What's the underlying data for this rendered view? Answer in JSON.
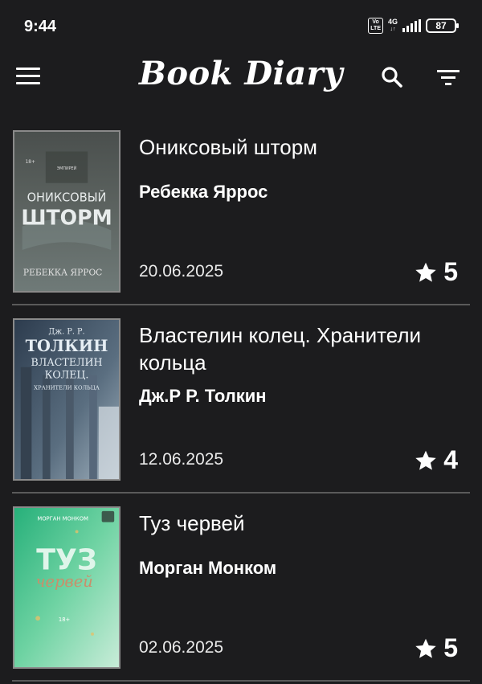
{
  "status_bar": {
    "time": "9:44",
    "volte": "Vo LTE",
    "network": "4G",
    "battery": "87"
  },
  "app_bar": {
    "title": "Book Diary",
    "menu_icon": "hamburger-menu-icon",
    "search_icon": "search-icon",
    "filter_icon": "filter-sort-icon"
  },
  "books": [
    {
      "title": "Ониксовый шторм",
      "author": "Ребекка Яррос",
      "date": "20.06.2025",
      "rating": "5",
      "cover": {
        "top_text": "ЭМПИРЕЙ",
        "badge": "18+",
        "line1": "ОНИКСОВЫЙ",
        "line2": "ШТОРМ",
        "author": "РЕБЕККА ЯРРОС"
      }
    },
    {
      "title": "Властелин колец. Хранители кольца",
      "author": "Дж.Р Р. Толкин",
      "date": "12.06.2025",
      "rating": "4",
      "cover": {
        "line1": "Дж. Р. Р.",
        "line2": "ТОЛКИН",
        "line3": "ВЛАСТЕЛИН",
        "line4": "КОЛЕЦ.",
        "line5": "ХРАНИТЕЛИ КОЛЬЦА"
      }
    },
    {
      "title": "Туз червей",
      "author": "Морган Монком",
      "date": "02.06.2025",
      "rating": "5",
      "cover": {
        "author": "МОРГАН МОНКОМ",
        "line1": "ТУЗ",
        "line2": "червей",
        "badge": "18+"
      }
    }
  ],
  "colors": {
    "background": "#1c1c1e",
    "divider": "#5a5a5a",
    "text": "#ffffff"
  }
}
